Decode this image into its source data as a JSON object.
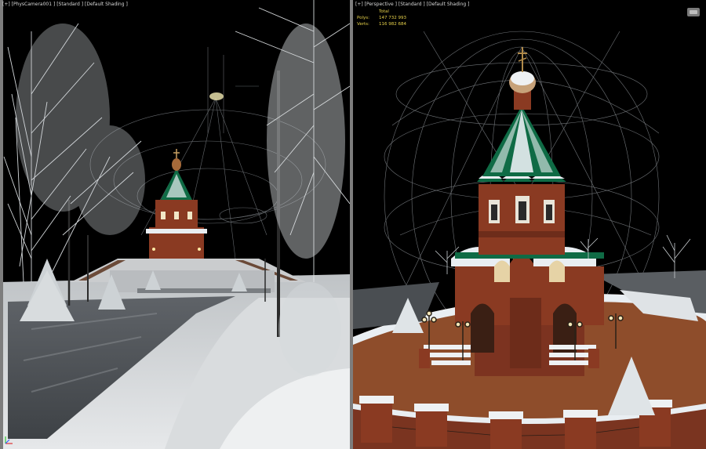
{
  "viewports": {
    "left": {
      "label": "[+] [PhysCamera001 ] [Standard ] [Default Shading ]"
    },
    "right": {
      "label": "[+] [Perspective ] [Standard ] [Default Shading ]",
      "stats": {
        "header": "Total",
        "polys_label": "Polys:",
        "polys_value": "147 732 993",
        "verts_label": "Verts:",
        "verts_value": "116 982 684"
      }
    }
  },
  "icons": {
    "nav": "viewport-navigation-icon",
    "axis": "axis-gizmo-icon"
  },
  "colors": {
    "active_border": "#d9b23a",
    "stats_text": "#e8d24a",
    "roof": "#0f6b45",
    "brick": "#8a3a22",
    "snow": "#e9eef2",
    "wire": "#9aa0a6",
    "ground_right": "#8e4d2b"
  }
}
